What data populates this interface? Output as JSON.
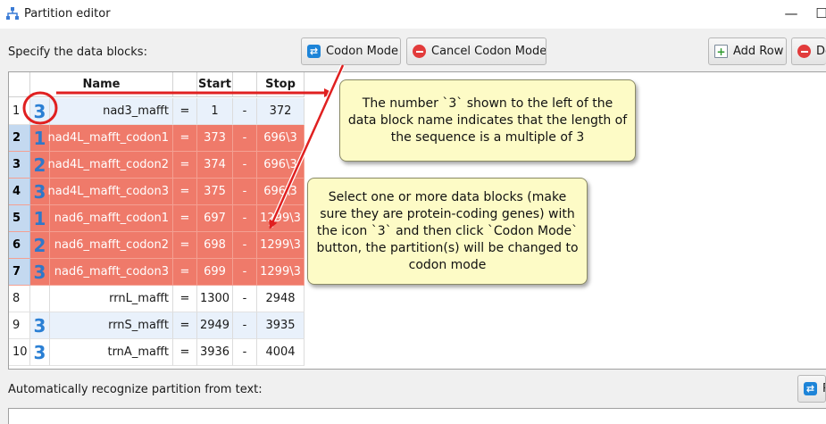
{
  "window": {
    "title": "Partition editor",
    "minimize": "—",
    "maximize": "☐"
  },
  "toolbar": {
    "spec_label": "Specify the data blocks:",
    "codon_mode": "Codon Mode",
    "cancel_codon_mode": "Cancel Codon Mode",
    "add_row": "Add Row",
    "delete_partial": "De"
  },
  "table": {
    "headers": {
      "name": "Name",
      "start": "Start",
      "stop": "Stop"
    },
    "rows": [
      {
        "num": "1",
        "icon": "3",
        "name": "nad3_mafft",
        "eq": "=",
        "start": "1",
        "dash": "-",
        "stop": "372",
        "state": "alt"
      },
      {
        "num": "2",
        "icon": "1",
        "name": "nad4L_mafft_codon1",
        "eq": "=",
        "start": "373",
        "dash": "-",
        "stop": "696\\3",
        "state": "sel"
      },
      {
        "num": "3",
        "icon": "2",
        "name": "nad4L_mafft_codon2",
        "eq": "=",
        "start": "374",
        "dash": "-",
        "stop": "696\\3",
        "state": "sel"
      },
      {
        "num": "4",
        "icon": "3",
        "name": "nad4L_mafft_codon3",
        "eq": "=",
        "start": "375",
        "dash": "-",
        "stop": "696\\3",
        "state": "sel"
      },
      {
        "num": "5",
        "icon": "1",
        "name": "nad6_mafft_codon1",
        "eq": "=",
        "start": "697",
        "dash": "-",
        "stop": "1299\\3",
        "state": "sel"
      },
      {
        "num": "6",
        "icon": "2",
        "name": "nad6_mafft_codon2",
        "eq": "=",
        "start": "698",
        "dash": "-",
        "stop": "1299\\3",
        "state": "sel"
      },
      {
        "num": "7",
        "icon": "3",
        "name": "nad6_mafft_codon3",
        "eq": "=",
        "start": "699",
        "dash": "-",
        "stop": "1299\\3",
        "state": "sel"
      },
      {
        "num": "8",
        "icon": "",
        "name": "rrnL_mafft",
        "eq": "=",
        "start": "1300",
        "dash": "-",
        "stop": "2948",
        "state": ""
      },
      {
        "num": "9",
        "icon": "3",
        "name": "rrnS_mafft",
        "eq": "=",
        "start": "2949",
        "dash": "-",
        "stop": "3935",
        "state": "alt"
      },
      {
        "num": "10",
        "icon": "3",
        "name": "trnA_mafft",
        "eq": "=",
        "start": "3936",
        "dash": "-",
        "stop": "4004",
        "state": ""
      }
    ]
  },
  "callouts": {
    "first": "The number `3` shown to the left of the data block name indicates that the length of the sequence is a multiple of 3",
    "second": "Select one or more data blocks (make sure they are protein-coding genes) with the icon `3` and then click `Codon Mode` button, the partition(s) will be changed to codon mode"
  },
  "bottom": {
    "auto_label": "Automatically recognize partition from text:",
    "r_button_partial": "R"
  },
  "colors": {
    "selected_row": "#ef7a6a",
    "row_header_selected": "#c4d9f0",
    "codon_icon": "#2a7fd4",
    "arrow": "#e02020",
    "callout_bg": "#fdfbc6"
  }
}
